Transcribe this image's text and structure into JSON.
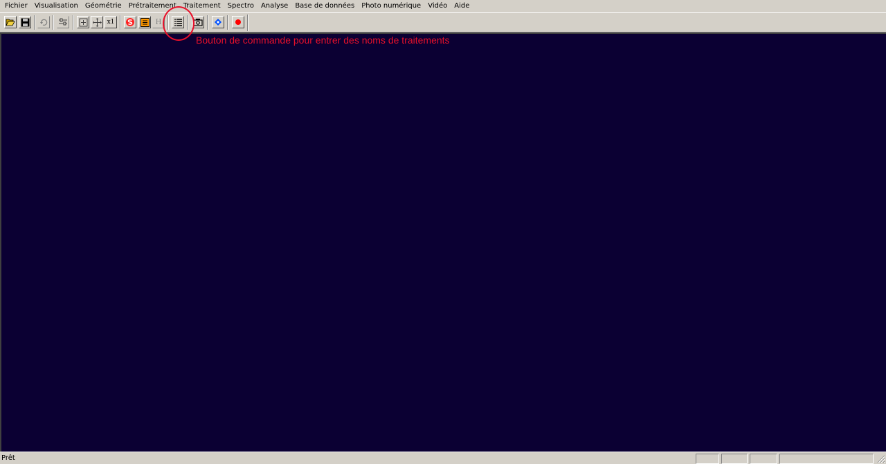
{
  "menu": [
    "Fichier",
    "Visualisation",
    "Géométrie",
    "Prétraitement",
    "Traitement",
    "Spectro",
    "Analyse",
    "Base de données",
    "Photo numérique",
    "Vidéo",
    "Aide"
  ],
  "toolbar": {
    "buttons": [
      {
        "name": "open-folder-icon"
      },
      {
        "name": "save-disk-icon"
      },
      {
        "name": "undo-icon"
      },
      {
        "name": "settings-sliders-icon"
      },
      {
        "name": "zoom-in-icon"
      },
      {
        "name": "pan-move-icon"
      },
      {
        "name": "zoom-1x-icon",
        "label": "x1"
      },
      {
        "name": "red-s-icon"
      },
      {
        "name": "orange-list-icon"
      },
      {
        "name": "h-letter-icon",
        "label": "H"
      },
      {
        "name": "processing-names-list-icon"
      },
      {
        "name": "camera-icon"
      },
      {
        "name": "blue-diamond-icon"
      },
      {
        "name": "record-red-dot-icon"
      }
    ]
  },
  "annotation": {
    "text": "Bouton de commande pour entrer des noms de traitements",
    "color": "#e8102a"
  },
  "workspace": {
    "background": "#0b0033"
  },
  "status": {
    "text": "Prêt"
  }
}
